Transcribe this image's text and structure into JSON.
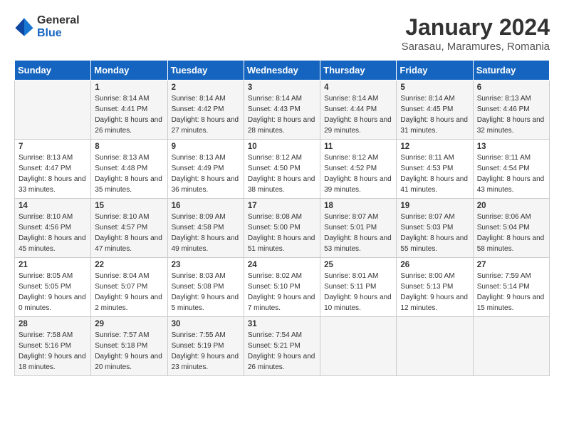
{
  "logo": {
    "general": "General",
    "blue": "Blue"
  },
  "title": "January 2024",
  "subtitle": "Sarasau, Maramures, Romania",
  "days_header": [
    "Sunday",
    "Monday",
    "Tuesday",
    "Wednesday",
    "Thursday",
    "Friday",
    "Saturday"
  ],
  "weeks": [
    [
      {
        "day": "",
        "sunrise": "",
        "sunset": "",
        "daylight": ""
      },
      {
        "day": "1",
        "sunrise": "Sunrise: 8:14 AM",
        "sunset": "Sunset: 4:41 PM",
        "daylight": "Daylight: 8 hours and 26 minutes."
      },
      {
        "day": "2",
        "sunrise": "Sunrise: 8:14 AM",
        "sunset": "Sunset: 4:42 PM",
        "daylight": "Daylight: 8 hours and 27 minutes."
      },
      {
        "day": "3",
        "sunrise": "Sunrise: 8:14 AM",
        "sunset": "Sunset: 4:43 PM",
        "daylight": "Daylight: 8 hours and 28 minutes."
      },
      {
        "day": "4",
        "sunrise": "Sunrise: 8:14 AM",
        "sunset": "Sunset: 4:44 PM",
        "daylight": "Daylight: 8 hours and 29 minutes."
      },
      {
        "day": "5",
        "sunrise": "Sunrise: 8:14 AM",
        "sunset": "Sunset: 4:45 PM",
        "daylight": "Daylight: 8 hours and 31 minutes."
      },
      {
        "day": "6",
        "sunrise": "Sunrise: 8:13 AM",
        "sunset": "Sunset: 4:46 PM",
        "daylight": "Daylight: 8 hours and 32 minutes."
      }
    ],
    [
      {
        "day": "7",
        "sunrise": "Sunrise: 8:13 AM",
        "sunset": "Sunset: 4:47 PM",
        "daylight": "Daylight: 8 hours and 33 minutes."
      },
      {
        "day": "8",
        "sunrise": "Sunrise: 8:13 AM",
        "sunset": "Sunset: 4:48 PM",
        "daylight": "Daylight: 8 hours and 35 minutes."
      },
      {
        "day": "9",
        "sunrise": "Sunrise: 8:13 AM",
        "sunset": "Sunset: 4:49 PM",
        "daylight": "Daylight: 8 hours and 36 minutes."
      },
      {
        "day": "10",
        "sunrise": "Sunrise: 8:12 AM",
        "sunset": "Sunset: 4:50 PM",
        "daylight": "Daylight: 8 hours and 38 minutes."
      },
      {
        "day": "11",
        "sunrise": "Sunrise: 8:12 AM",
        "sunset": "Sunset: 4:52 PM",
        "daylight": "Daylight: 8 hours and 39 minutes."
      },
      {
        "day": "12",
        "sunrise": "Sunrise: 8:11 AM",
        "sunset": "Sunset: 4:53 PM",
        "daylight": "Daylight: 8 hours and 41 minutes."
      },
      {
        "day": "13",
        "sunrise": "Sunrise: 8:11 AM",
        "sunset": "Sunset: 4:54 PM",
        "daylight": "Daylight: 8 hours and 43 minutes."
      }
    ],
    [
      {
        "day": "14",
        "sunrise": "Sunrise: 8:10 AM",
        "sunset": "Sunset: 4:56 PM",
        "daylight": "Daylight: 8 hours and 45 minutes."
      },
      {
        "day": "15",
        "sunrise": "Sunrise: 8:10 AM",
        "sunset": "Sunset: 4:57 PM",
        "daylight": "Daylight: 8 hours and 47 minutes."
      },
      {
        "day": "16",
        "sunrise": "Sunrise: 8:09 AM",
        "sunset": "Sunset: 4:58 PM",
        "daylight": "Daylight: 8 hours and 49 minutes."
      },
      {
        "day": "17",
        "sunrise": "Sunrise: 8:08 AM",
        "sunset": "Sunset: 5:00 PM",
        "daylight": "Daylight: 8 hours and 51 minutes."
      },
      {
        "day": "18",
        "sunrise": "Sunrise: 8:07 AM",
        "sunset": "Sunset: 5:01 PM",
        "daylight": "Daylight: 8 hours and 53 minutes."
      },
      {
        "day": "19",
        "sunrise": "Sunrise: 8:07 AM",
        "sunset": "Sunset: 5:03 PM",
        "daylight": "Daylight: 8 hours and 55 minutes."
      },
      {
        "day": "20",
        "sunrise": "Sunrise: 8:06 AM",
        "sunset": "Sunset: 5:04 PM",
        "daylight": "Daylight: 8 hours and 58 minutes."
      }
    ],
    [
      {
        "day": "21",
        "sunrise": "Sunrise: 8:05 AM",
        "sunset": "Sunset: 5:05 PM",
        "daylight": "Daylight: 9 hours and 0 minutes."
      },
      {
        "day": "22",
        "sunrise": "Sunrise: 8:04 AM",
        "sunset": "Sunset: 5:07 PM",
        "daylight": "Daylight: 9 hours and 2 minutes."
      },
      {
        "day": "23",
        "sunrise": "Sunrise: 8:03 AM",
        "sunset": "Sunset: 5:08 PM",
        "daylight": "Daylight: 9 hours and 5 minutes."
      },
      {
        "day": "24",
        "sunrise": "Sunrise: 8:02 AM",
        "sunset": "Sunset: 5:10 PM",
        "daylight": "Daylight: 9 hours and 7 minutes."
      },
      {
        "day": "25",
        "sunrise": "Sunrise: 8:01 AM",
        "sunset": "Sunset: 5:11 PM",
        "daylight": "Daylight: 9 hours and 10 minutes."
      },
      {
        "day": "26",
        "sunrise": "Sunrise: 8:00 AM",
        "sunset": "Sunset: 5:13 PM",
        "daylight": "Daylight: 9 hours and 12 minutes."
      },
      {
        "day": "27",
        "sunrise": "Sunrise: 7:59 AM",
        "sunset": "Sunset: 5:14 PM",
        "daylight": "Daylight: 9 hours and 15 minutes."
      }
    ],
    [
      {
        "day": "28",
        "sunrise": "Sunrise: 7:58 AM",
        "sunset": "Sunset: 5:16 PM",
        "daylight": "Daylight: 9 hours and 18 minutes."
      },
      {
        "day": "29",
        "sunrise": "Sunrise: 7:57 AM",
        "sunset": "Sunset: 5:18 PM",
        "daylight": "Daylight: 9 hours and 20 minutes."
      },
      {
        "day": "30",
        "sunrise": "Sunrise: 7:55 AM",
        "sunset": "Sunset: 5:19 PM",
        "daylight": "Daylight: 9 hours and 23 minutes."
      },
      {
        "day": "31",
        "sunrise": "Sunrise: 7:54 AM",
        "sunset": "Sunset: 5:21 PM",
        "daylight": "Daylight: 9 hours and 26 minutes."
      },
      {
        "day": "",
        "sunrise": "",
        "sunset": "",
        "daylight": ""
      },
      {
        "day": "",
        "sunrise": "",
        "sunset": "",
        "daylight": ""
      },
      {
        "day": "",
        "sunrise": "",
        "sunset": "",
        "daylight": ""
      }
    ]
  ]
}
